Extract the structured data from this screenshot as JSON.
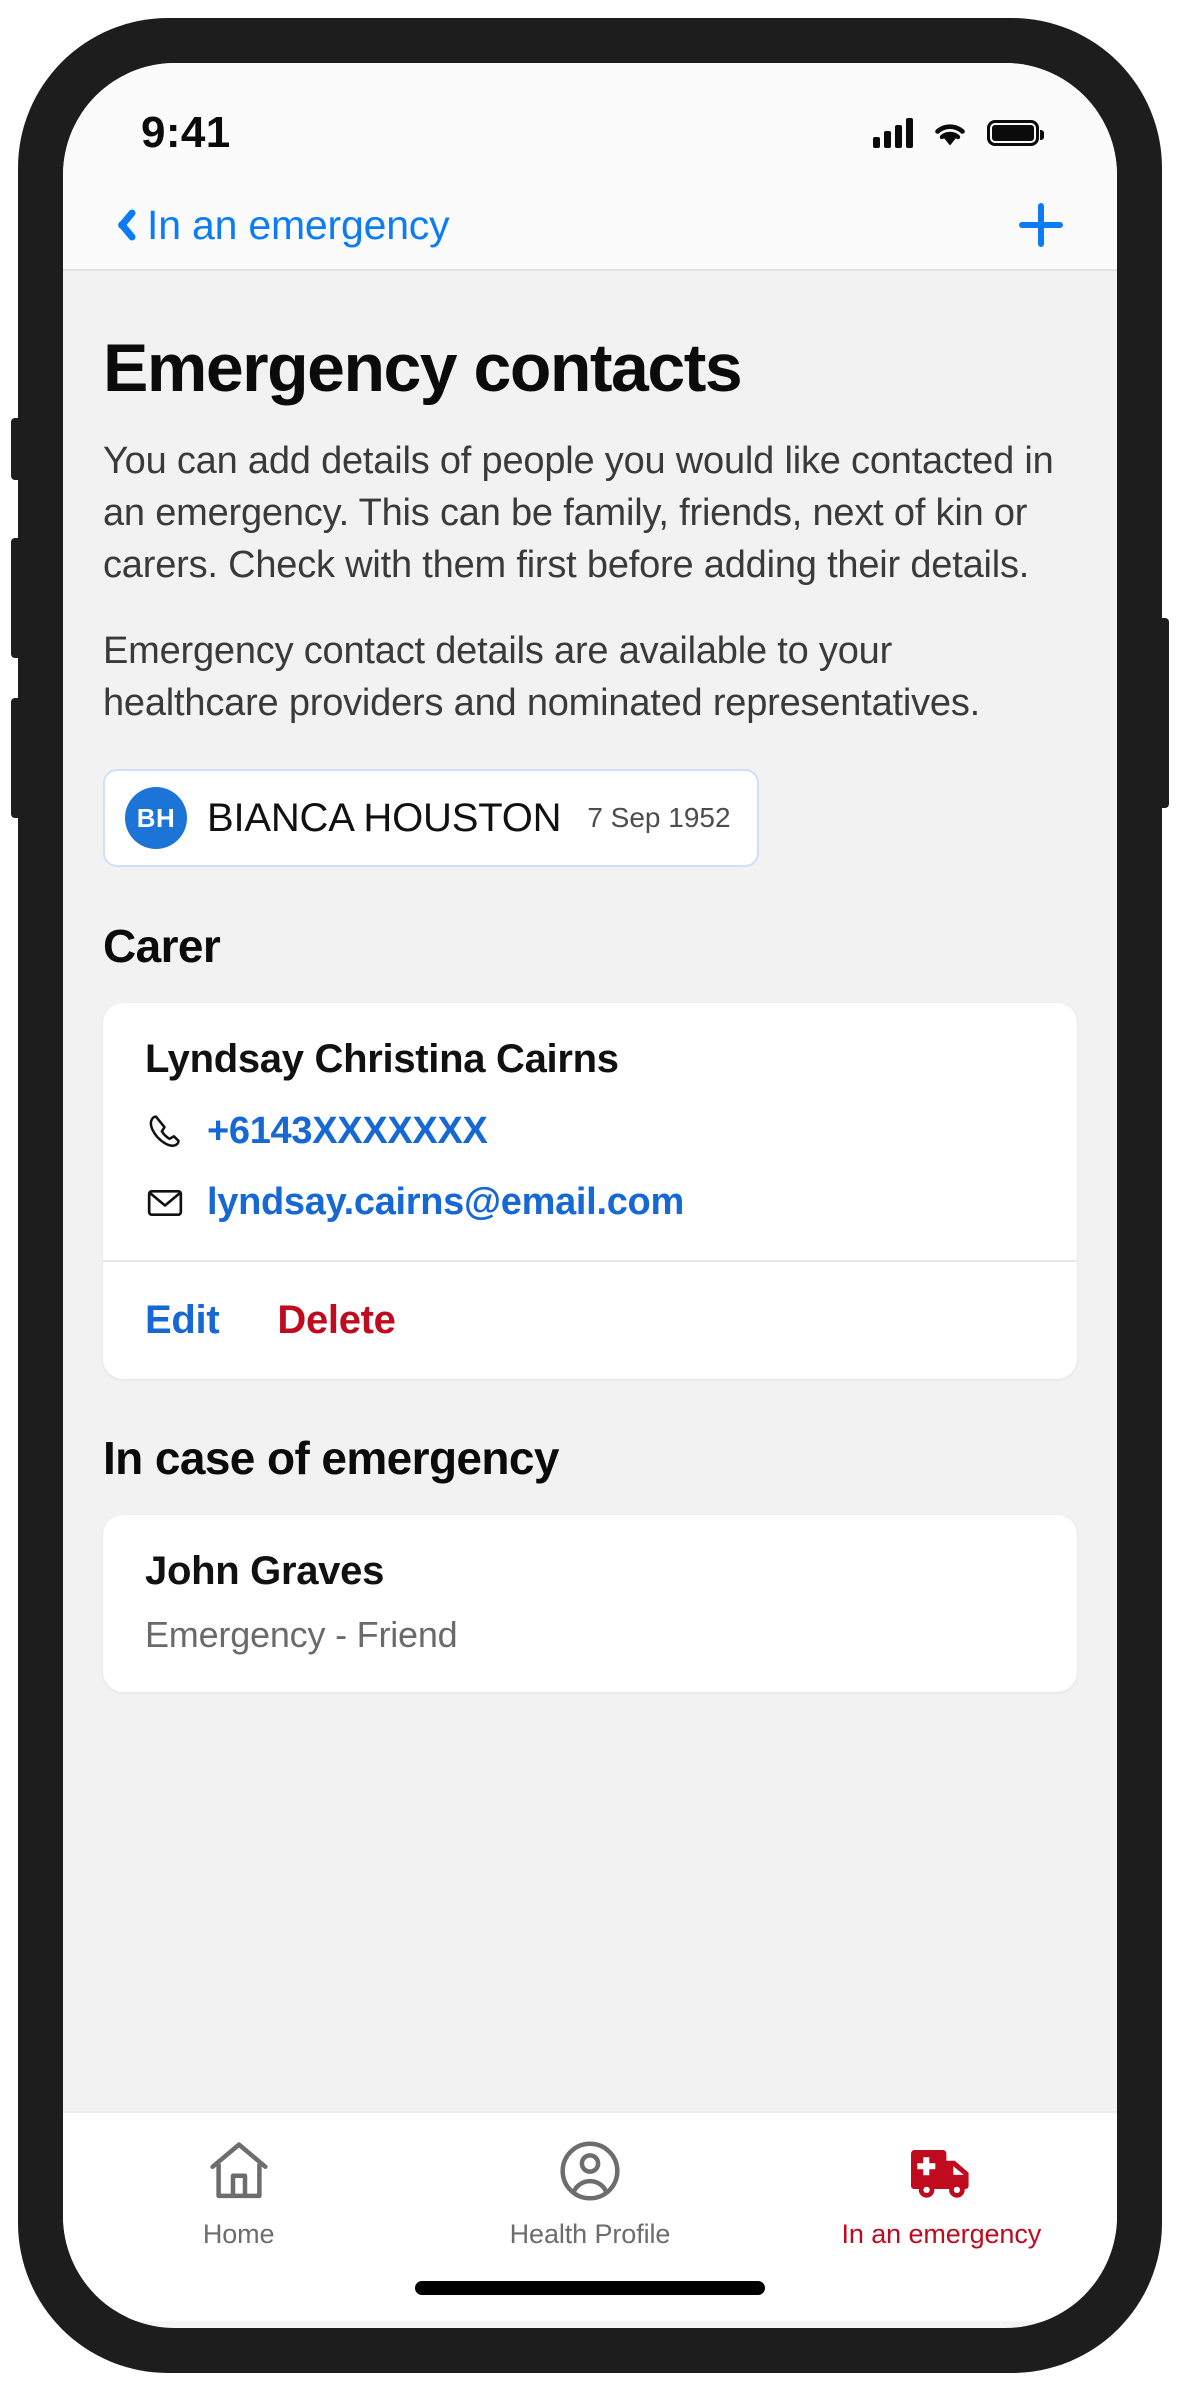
{
  "status_bar": {
    "time": "9:41",
    "signal_icon": "cellular-signal-icon",
    "wifi_icon": "wifi-icon",
    "battery_icon": "battery-full-icon"
  },
  "nav_bar": {
    "back_icon": "chevron-left-icon",
    "title": "In an emergency",
    "add_icon": "plus-icon"
  },
  "page": {
    "title": "Emergency contacts",
    "paragraph_1": "You can add details of people you would like contacted in an emergency. This can be family, friends, next of kin or carers. Check with them first before adding their details.",
    "paragraph_2": "Emergency contact details are available to your healthcare providers and nominated representatives."
  },
  "patient": {
    "initials": "BH",
    "name": "BIANCA HOUSTON",
    "dob": "7 Sep 1952"
  },
  "sections": [
    {
      "heading": "Carer",
      "contact": {
        "name": "Lyndsay Christina Cairns",
        "phone": "+6143XXXXXXX",
        "phone_icon": "phone-icon",
        "email": "lyndsay.cairns@email.com",
        "email_icon": "envelope-icon",
        "edit_label": "Edit",
        "delete_label": "Delete"
      }
    },
    {
      "heading": "In case of emergency",
      "contact": {
        "name": "John Graves",
        "relationship": "Emergency - Friend"
      }
    }
  ],
  "tab_bar": {
    "tabs": [
      {
        "label": "Home",
        "icon": "home-icon",
        "active": false
      },
      {
        "label": "Health Profile",
        "icon": "person-circle-icon",
        "active": false
      },
      {
        "label": "In an emergency",
        "icon": "ambulance-icon",
        "active": true
      }
    ]
  },
  "colors": {
    "accent_blue": "#0b7cf5",
    "link_blue": "#1668d4",
    "danger_red": "#c00a1e",
    "avatar_blue": "#1b74d6",
    "page_background": "#f2f2f2",
    "card_background": "#ffffff"
  }
}
